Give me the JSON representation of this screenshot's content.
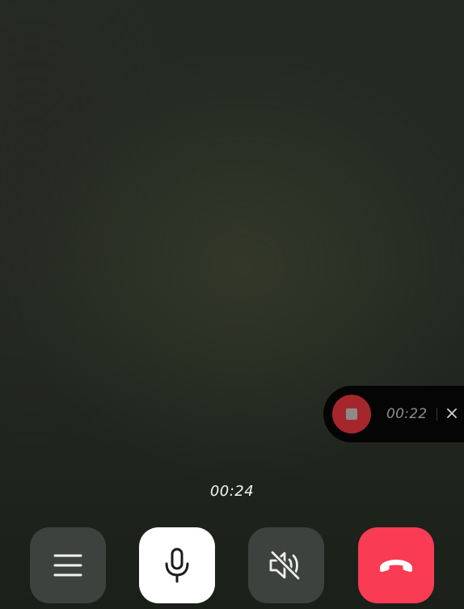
{
  "call": {
    "duration": "00:24"
  },
  "recording": {
    "elapsed": "00:22"
  },
  "controls": {
    "menu_icon": "menu-icon",
    "mic_icon": "microphone-icon",
    "speaker_icon": "speaker-muted-icon",
    "hangup_icon": "hang-up-icon",
    "stop_icon": "stop-icon",
    "close_icon": "close-icon"
  },
  "colors": {
    "hangup": "#fa3b54",
    "record_stop": "#a6272b",
    "control_dark": "#3e423e",
    "control_light": "#ffffff"
  }
}
